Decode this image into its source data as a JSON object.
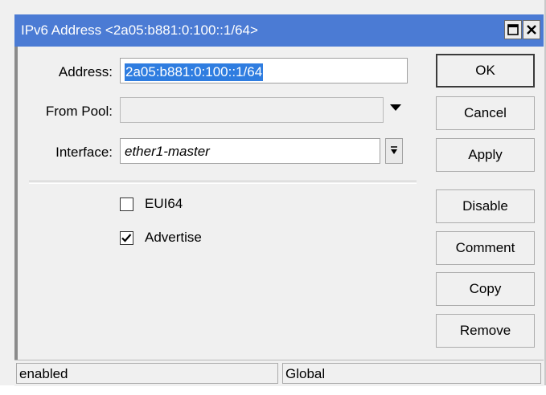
{
  "window": {
    "title": "IPv6 Address <2a05:b881:0:100::1/64>",
    "title_bg": "#4b7bd4",
    "maximize_icon": "maximize-icon",
    "close_icon": "close-icon"
  },
  "form": {
    "address_label": "Address:",
    "address_value": "2a05:b881:0:100::1/64",
    "from_pool_label": "From Pool:",
    "from_pool_value": "",
    "interface_label": "Interface:",
    "interface_value": "ether1-master",
    "eui64_label": "EUI64",
    "eui64_checked": false,
    "advertise_label": "Advertise",
    "advertise_checked": true
  },
  "buttons": {
    "ok": "OK",
    "cancel": "Cancel",
    "apply": "Apply",
    "disable": "Disable",
    "comment": "Comment",
    "copy": "Copy",
    "remove": "Remove"
  },
  "status": {
    "state": "enabled",
    "scope": "Global"
  }
}
